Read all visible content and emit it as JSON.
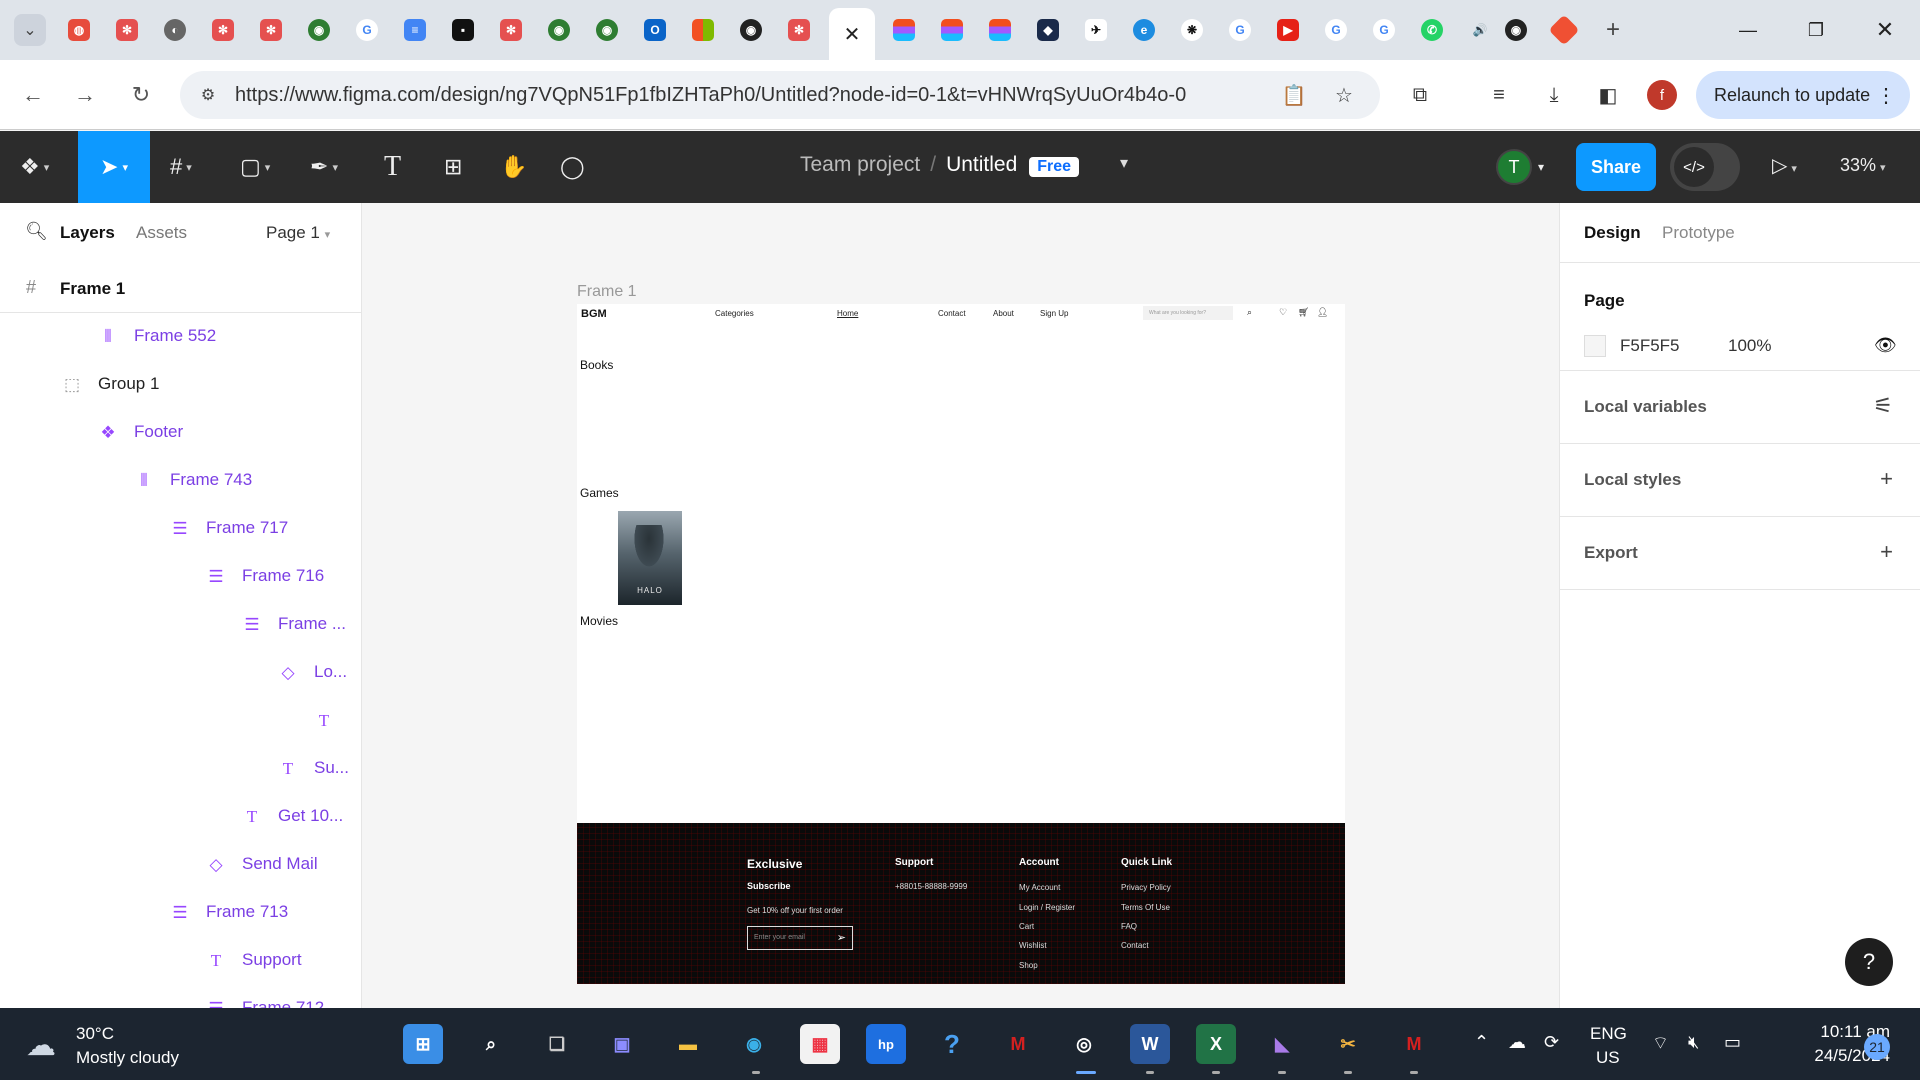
{
  "browser": {
    "tab_icons": [
      "menu-dropdown",
      "red-app",
      "gear-red",
      "globe",
      "gear-red",
      "gear-red",
      "github",
      "google",
      "docs",
      "black-app",
      "gear-red",
      "github",
      "github",
      "outlook",
      "microsoft",
      "github",
      "gear-red",
      "figma",
      "figma",
      "figma",
      "diamond-app",
      "bird-app",
      "edge-copilot",
      "chatgpt",
      "google",
      "youtube",
      "google",
      "google",
      "whatsapp",
      "audio",
      "github",
      "git-app"
    ],
    "active_tab_close": "✕",
    "new_tab": "+",
    "url": "https://www.figma.com/design/ng7VQpN51Fp1fbIZHTaPh0/Untitled?node-id=0-1&t=vHNWrqSyUuOr4b4o-0",
    "profile_initial": "f",
    "relaunch_label": "Relaunch to update"
  },
  "figma": {
    "team": "Team project",
    "file_name": "Untitled",
    "plan_badge": "Free",
    "user_initial": "T",
    "share_label": "Share",
    "zoom": "33%"
  },
  "layers_panel": {
    "tab_layers": "Layers",
    "tab_assets": "Assets",
    "page": "Page 1",
    "root_frame": "Frame 1",
    "rows": [
      {
        "label": "Frame 552",
        "icon": "auto-layout-icon",
        "indent": 1,
        "dark": false
      },
      {
        "label": "Group 1",
        "icon": "group-icon",
        "indent": 0,
        "dark": true
      },
      {
        "label": "Footer",
        "icon": "component-icon",
        "indent": 1,
        "dark": false
      },
      {
        "label": "Frame 743",
        "icon": "auto-layout-icon",
        "indent": 2,
        "dark": false
      },
      {
        "label": "Frame 717",
        "icon": "stack-icon",
        "indent": 3,
        "dark": false
      },
      {
        "label": "Frame 716",
        "icon": "stack-icon",
        "indent": 4,
        "dark": false
      },
      {
        "label": "Frame ...",
        "icon": "stack-icon",
        "indent": 5,
        "dark": false
      },
      {
        "label": "Lo...",
        "icon": "instance-icon",
        "indent": 6,
        "dark": false
      },
      {
        "label": "",
        "icon": "text-icon",
        "indent": 7,
        "dark": false
      },
      {
        "label": "Su...",
        "icon": "text-icon",
        "indent": 6,
        "dark": false
      },
      {
        "label": "Get 10...",
        "icon": "text-icon",
        "indent": 5,
        "dark": false
      },
      {
        "label": "Send Mail",
        "icon": "instance-icon",
        "indent": 4,
        "dark": false
      },
      {
        "label": "Frame 713",
        "icon": "stack-icon",
        "indent": 3,
        "dark": false
      },
      {
        "label": "Support",
        "icon": "text-icon",
        "indent": 4,
        "dark": false
      },
      {
        "label": "Frame 712",
        "icon": "stack-icon",
        "indent": 4,
        "dark": false
      }
    ]
  },
  "canvas": {
    "frame_tag": "Frame 1",
    "site": {
      "logo": "BGM",
      "nav": [
        "Categories",
        "Home",
        "Contact",
        "About",
        "Sign Up"
      ],
      "search_placeholder": "What are you looking for?",
      "sections": [
        "Books",
        "Games",
        "Movies"
      ],
      "poster_title": "HALO",
      "footer": {
        "brand": "Exclusive",
        "subscribe": "Subscribe",
        "offer": "Get 10% off your first order",
        "email_placeholder": "Enter your email",
        "support_title": "Support",
        "support_phone": "+88015-88888-9999",
        "account_title": "Account",
        "account_links": [
          "My Account",
          "Login / Register",
          "Cart",
          "Wishlist",
          "Shop"
        ],
        "quick_title": "Quick Link",
        "quick_links": [
          "Privacy Policy",
          "Terms Of Use",
          "FAQ",
          "Contact"
        ]
      }
    }
  },
  "design_panel": {
    "tab_design": "Design",
    "tab_prototype": "Prototype",
    "page_title": "Page",
    "page_color": "F5F5F5",
    "page_opacity": "100%",
    "local_variables": "Local variables",
    "local_styles": "Local styles",
    "export": "Export"
  },
  "taskbar": {
    "temperature": "30°C",
    "weather": "Mostly cloudy",
    "lang": "ENG",
    "region": "US",
    "time": "10:11 am",
    "date": "24/5/2024",
    "notifications": "21"
  }
}
